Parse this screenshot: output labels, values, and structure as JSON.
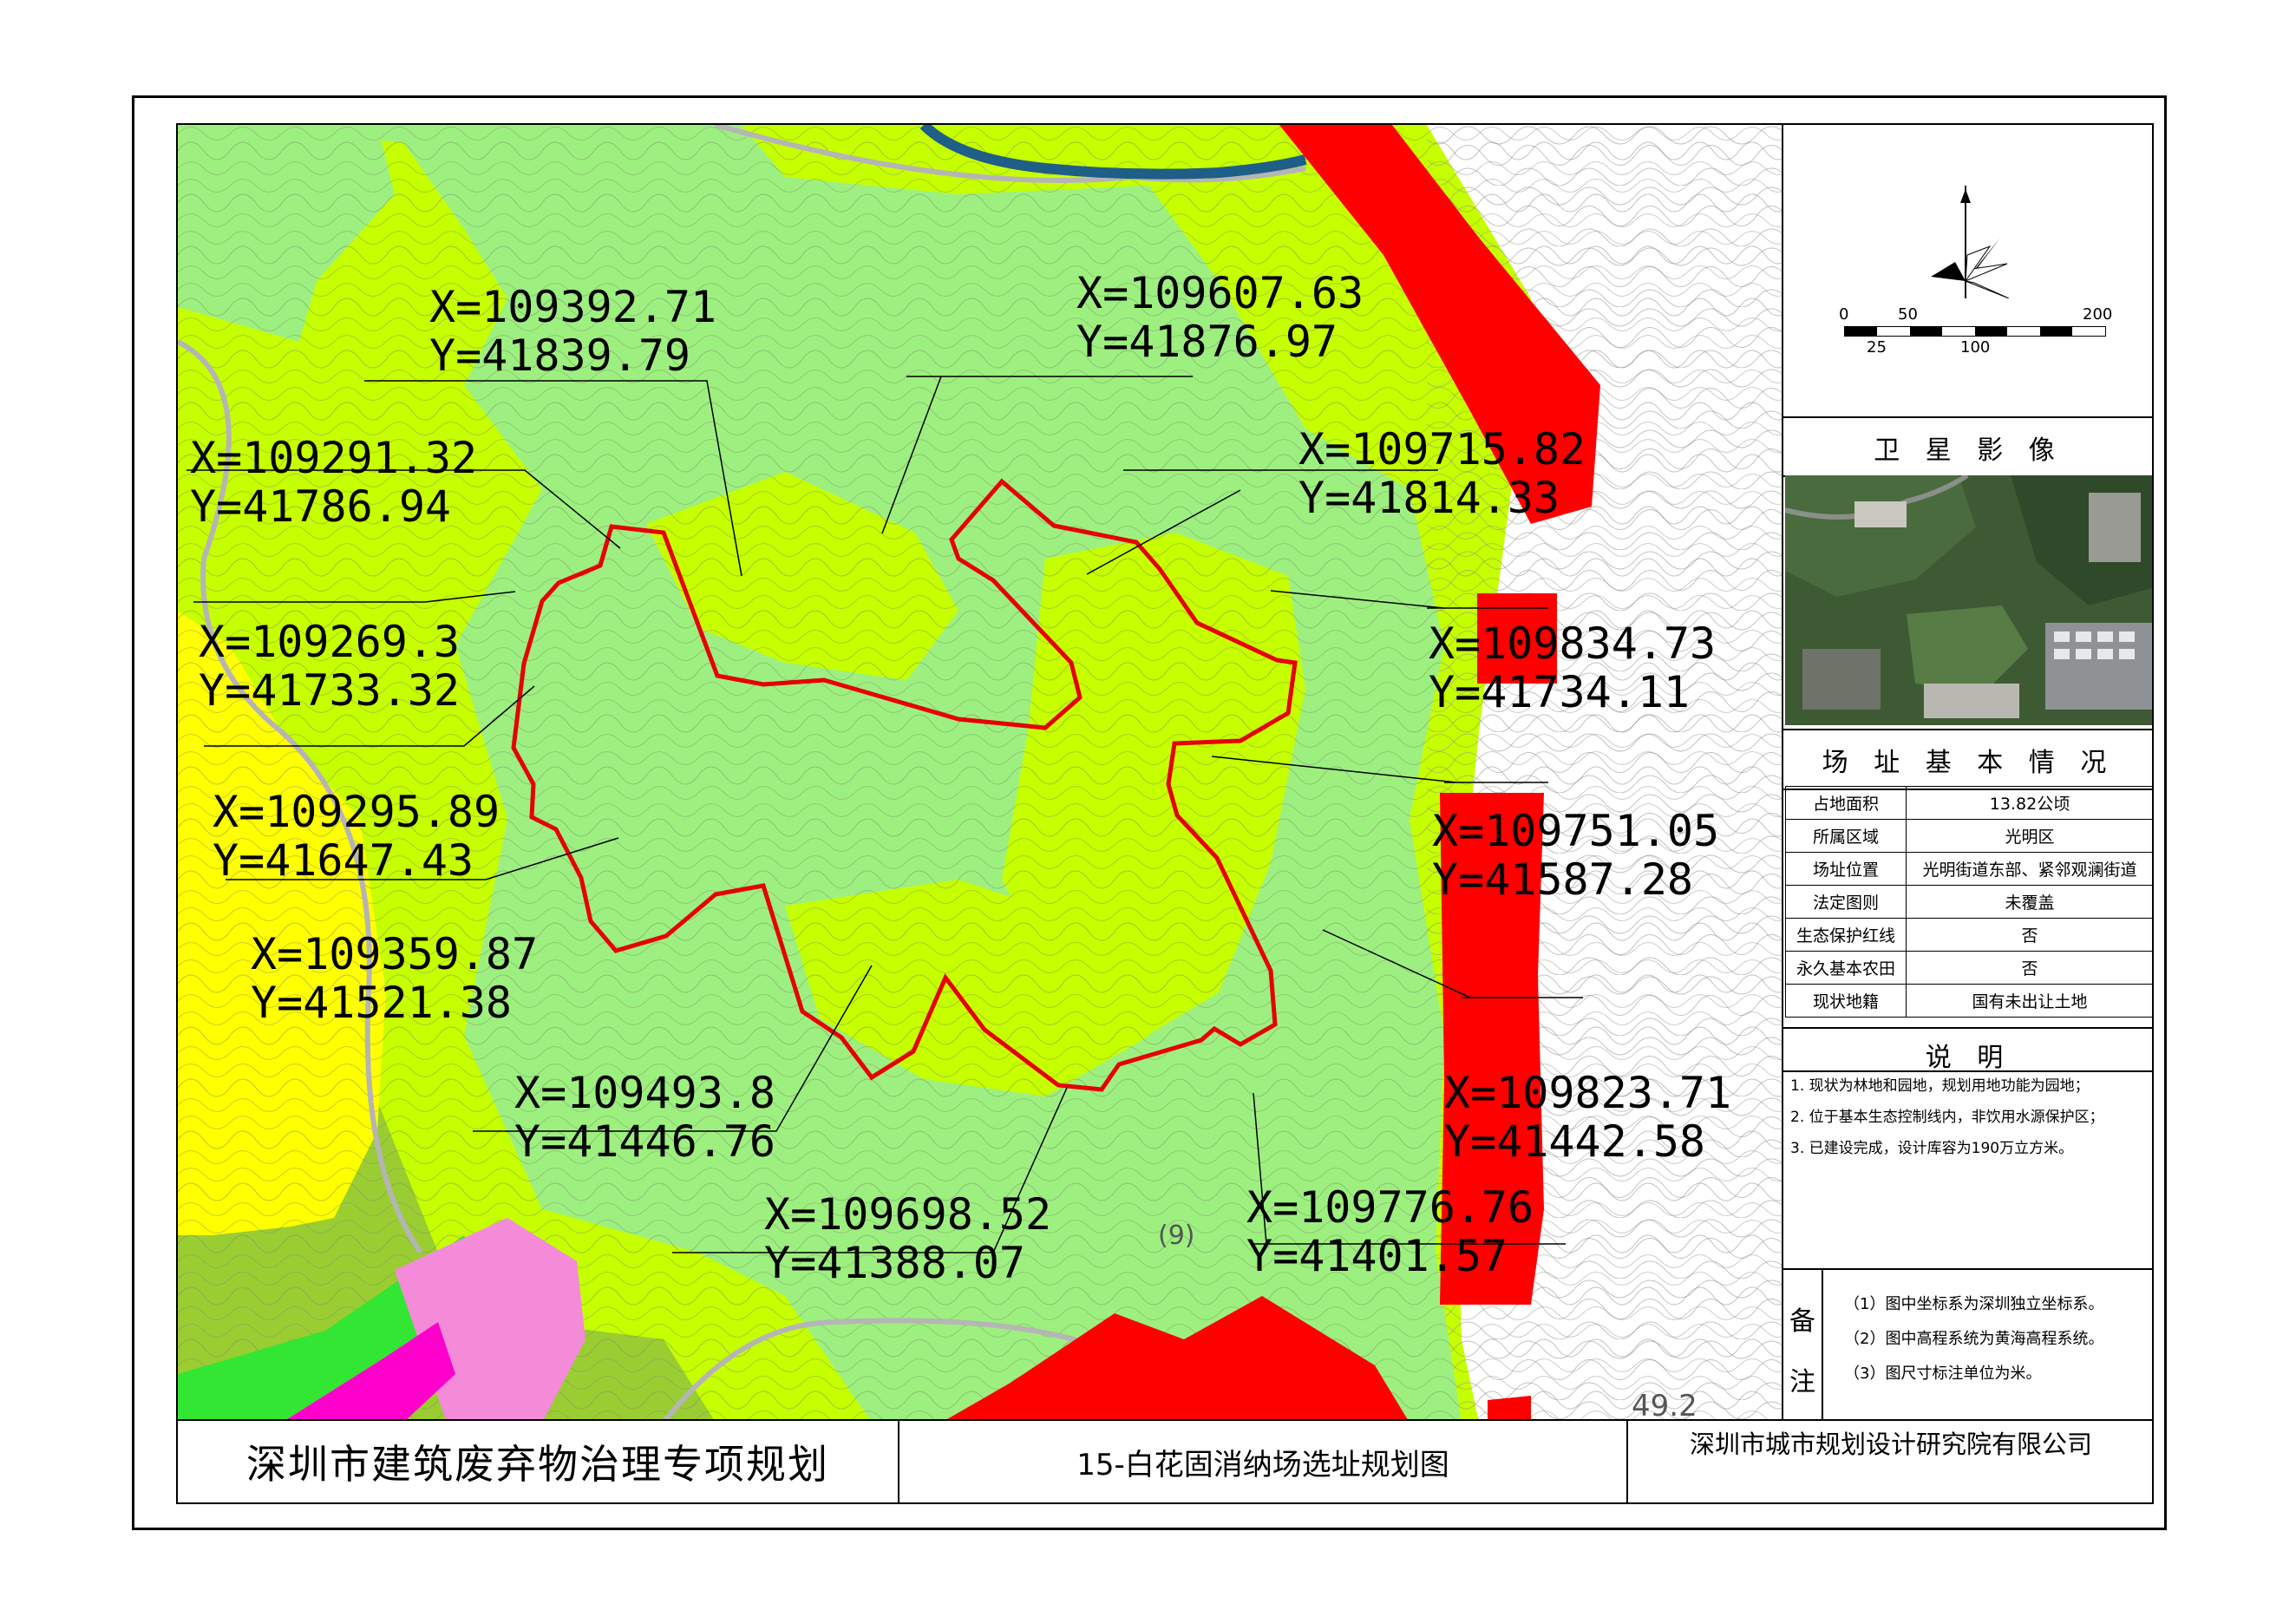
{
  "map": {
    "coordinates": [
      {
        "x": "X=109392.71",
        "y": "Y=41839.79"
      },
      {
        "x": "X=109607.63",
        "y": "Y=41876.97"
      },
      {
        "x": "X=109291.32",
        "y": "Y=41786.94"
      },
      {
        "x": "X=109715.82",
        "y": "Y=41814.33"
      },
      {
        "x": "X=109269.3",
        "y": "Y=41733.32"
      },
      {
        "x": "X=109834.73",
        "y": "Y=41734.11"
      },
      {
        "x": "X=109295.89",
        "y": "Y=41647.43"
      },
      {
        "x": "X=109751.05",
        "y": "Y=41587.28"
      },
      {
        "x": "X=109359.87",
        "y": "Y=41521.38"
      },
      {
        "x": "X=109823.71",
        "y": "Y=41442.58"
      },
      {
        "x": "X=109493.8",
        "y": "Y=41446.76"
      },
      {
        "x": "X=109776.76",
        "y": "Y=41401.57"
      },
      {
        "x": "X=109698.52",
        "y": "Y=41388.07"
      }
    ],
    "road_label": "(9)",
    "elevation_label": "49.2"
  },
  "legend": {
    "scale_ticks_top": [
      "0",
      "50",
      "200"
    ],
    "scale_ticks_bottom": [
      "25",
      "100"
    ],
    "satellite_title": "卫 星 影 像",
    "site_title": "场 址 基 本 情 况",
    "site_info": [
      {
        "key": "占地面积",
        "value": "13.82公顷"
      },
      {
        "key": "所属区域",
        "value": "光明区"
      },
      {
        "key": "场址位置",
        "value": "光明街道东部、紧邻观澜街道"
      },
      {
        "key": "法定图则",
        "value": "未覆盖"
      },
      {
        "key": "生态保护红线",
        "value": "否"
      },
      {
        "key": "永久基本农田",
        "value": "否"
      },
      {
        "key": "现状地籍",
        "value": "国有未出让土地"
      }
    ],
    "explain_title": "说 明",
    "explain_items": [
      "1. 现状为林地和园地，规划用地功能为园地；",
      "2. 位于基本生态控制线内，非饮用水源保护区；",
      "3. 已建设完成，设计库容为190万立方米。"
    ],
    "remarks_label_1": "备",
    "remarks_label_2": "注",
    "remarks": [
      "（1）图中坐标系为深圳独立坐标系。",
      "（2）图中高程系统为黄海高程系统。",
      "（3）图尺寸标注单位为米。"
    ]
  },
  "footer": {
    "plan_title": "深圳市建筑废弃物治理专项规划",
    "map_title": "15-白花固消纳场选址规划图",
    "institute": "深圳市城市规划设计研究院有限公司"
  },
  "colors": {
    "forest_light": "#9df07f",
    "forest_yellowgreen": "#c6ff00",
    "olive": "#9acd32",
    "yellow": "#ffff00",
    "red": "#ff0000",
    "pink": "#f48bd9",
    "magenta": "#ff00cc",
    "green": "#33e633",
    "river": "#1f5e86",
    "boundary": "#e60000"
  }
}
